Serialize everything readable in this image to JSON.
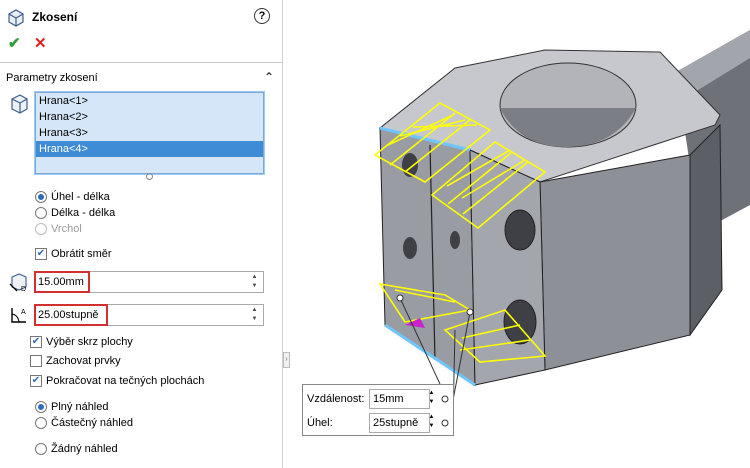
{
  "panel": {
    "title": "Zkosení",
    "help_label": "?",
    "ok_label": "✔",
    "cancel_label": "✕",
    "group_title": "Parametry zkosení",
    "edges": [
      "Hrana<1>",
      "Hrana<2>",
      "Hrana<3>",
      "Hrana<4>"
    ],
    "selected_edge": "Hrana<4>",
    "mode_options": [
      {
        "label": "Úhel - délka",
        "checked": true,
        "enabled": true
      },
      {
        "label": "Délka - délka",
        "checked": false,
        "enabled": true
      },
      {
        "label": "Vrchol",
        "checked": false,
        "enabled": false
      }
    ],
    "flip_label": "Obrátit směr",
    "flip_checked": true,
    "distance_value": "15.00mm",
    "angle_value": "25.00stupně",
    "options": [
      {
        "label": "Výběr skrz plochy",
        "checked": true
      },
      {
        "label": "Zachovat prvky",
        "checked": false
      },
      {
        "label": "Pokračovat na tečných plochách",
        "checked": true
      }
    ],
    "preview_options": [
      {
        "label": "Plný náhled",
        "checked": true
      },
      {
        "label": "Částečný náhled",
        "checked": false
      },
      {
        "label": "Žádný náhled",
        "checked": false
      }
    ]
  },
  "callout": {
    "distance_label": "Vzdálenost:",
    "distance_value": "15mm",
    "angle_label": "Úhel:",
    "angle_value": "25stupně"
  },
  "colors": {
    "accent": "#3f8cd6",
    "list_bg": "#d5e6f8",
    "highlight_box": "#d23030",
    "preview_yellow": "#ffff00",
    "part_gray": "#9a9ca3"
  }
}
